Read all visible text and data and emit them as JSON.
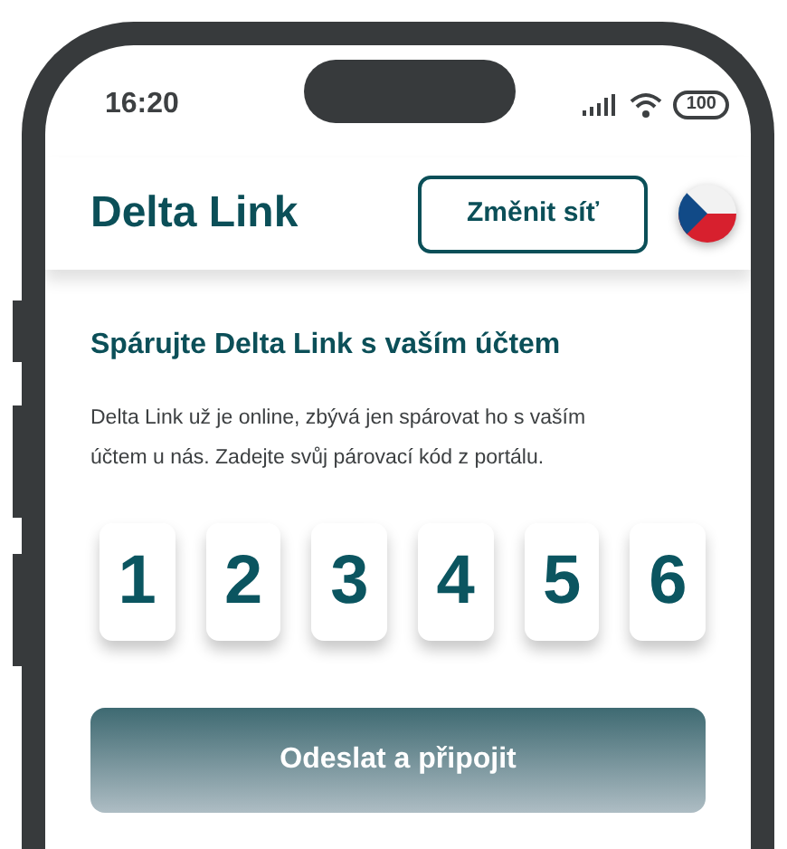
{
  "status_bar": {
    "time": "16:20",
    "battery": "100"
  },
  "header": {
    "title": "Delta Link",
    "change_network_button": "Změnit síť"
  },
  "pairing": {
    "heading": "Spárujte Delta Link s vaším účtem",
    "description": "Delta Link už je online, zbývá jen spárovat ho s vaším účtem u nás. Zadejte svůj párovací kód z portálu.",
    "code_digits": [
      "1",
      "2",
      "3",
      "4",
      "5",
      "6"
    ],
    "submit_button": "Odeslat a připojit"
  }
}
